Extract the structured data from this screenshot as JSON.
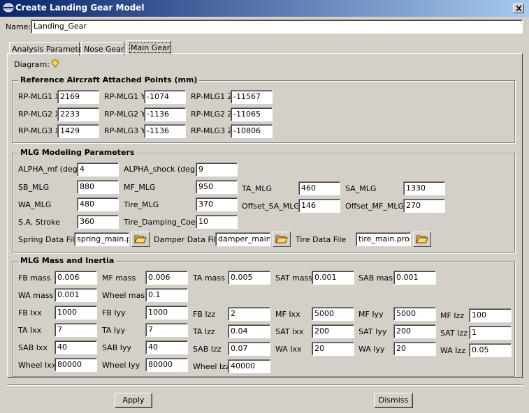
{
  "window": {
    "title": "Create Landing Gear Model"
  },
  "name_row": {
    "label": "Name:",
    "value": "Landing_Gear"
  },
  "tabs": [
    "Analysis Parameters",
    "Nose Gear",
    "Main Gear"
  ],
  "diagram": {
    "label": "Diagram:",
    "icon": "lightbulb-icon"
  },
  "ref_points": {
    "title": "Reference Aircraft Attached Points (mm)",
    "rows": [
      [
        {
          "label": "RP-MLG1 X",
          "value": "2169"
        },
        {
          "label": "RP-MLG1 Y",
          "value": "-1074"
        },
        {
          "label": "RP-MLG1 Z",
          "value": "-11567"
        }
      ],
      [
        {
          "label": "RP-MLG2 X",
          "value": "2233"
        },
        {
          "label": "RP-MLG2 Y",
          "value": "-1136"
        },
        {
          "label": "RP-MLG2 Z",
          "value": "-11065"
        }
      ],
      [
        {
          "label": "RP-MLG3 X",
          "value": "1429"
        },
        {
          "label": "RP-MLG3 Y",
          "value": "-1136"
        },
        {
          "label": "RP-MLG3 Z",
          "value": "-10806"
        }
      ]
    ]
  },
  "mlg_params": {
    "title": "MLG Modeling Parameters",
    "alpha_mf": {
      "label": "ALPHA_mf (deg)",
      "value": "4"
    },
    "alpha_shock": {
      "label": "ALPHA_shock (deg)",
      "value": "9"
    },
    "sb_mlg": {
      "label": "SB_MLG",
      "value": "880"
    },
    "mf_mlg": {
      "label": "MF_MLG",
      "value": "950"
    },
    "ta_mlg": {
      "label": "TA_MLG",
      "value": "460"
    },
    "sa_mlg": {
      "label": "SA_MLG",
      "value": "1330"
    },
    "wa_mlg": {
      "label": "WA_MLG",
      "value": "480"
    },
    "tire_mlg": {
      "label": "Tire_MLG",
      "value": "370"
    },
    "offset_sa": {
      "label": "Offset_SA_MLG",
      "value": "146"
    },
    "offset_mf": {
      "label": "Offset_MF_MLG",
      "value": "270"
    },
    "sa_stroke": {
      "label": "S.A. Stroke",
      "value": "360"
    },
    "tire_damping": {
      "label": "Tire_Damping_Coeff",
      "value": "10"
    },
    "spring_file": {
      "label": "Spring Data File",
      "value": "spring_main.prop"
    },
    "damper_file": {
      "label": "Damper Data File",
      "value": "damper_main.prop"
    },
    "tire_file": {
      "label": "Tire Data File",
      "value": "tire_main.prop"
    }
  },
  "mass": {
    "title": "MLG Mass and Inertia",
    "fb_mass": {
      "label": "FB mass",
      "value": "0.006"
    },
    "mf_mass": {
      "label": "MF mass",
      "value": "0.006"
    },
    "ta_mass": {
      "label": "TA mass",
      "value": "0.005"
    },
    "sat_mass": {
      "label": "SAT mass",
      "value": "0.001"
    },
    "sab_mass": {
      "label": "SAB mass",
      "value": "0.001"
    },
    "wa_mass": {
      "label": "WA mass",
      "value": "0.001"
    },
    "wheel_mass": {
      "label": "Wheel mass",
      "value": "0.1"
    },
    "fb_ixx": {
      "label": "FB Ixx",
      "value": "1000"
    },
    "fb_iyy": {
      "label": "FB Iyy",
      "value": "1000"
    },
    "fb_izz": {
      "label": "FB Izz",
      "value": "2"
    },
    "mf_ixx": {
      "label": "MF Ixx",
      "value": "5000"
    },
    "mf_iyy": {
      "label": "MF Iyy",
      "value": "5000"
    },
    "mf_izz": {
      "label": "MF Izz",
      "value": "100"
    },
    "ta_ixx": {
      "label": "TA Ixx",
      "value": "7"
    },
    "ta_iyy": {
      "label": "TA Iyy",
      "value": "7"
    },
    "ta_izz": {
      "label": "TA Izz",
      "value": "0.04"
    },
    "sat_ixx": {
      "label": "SAT Ixx",
      "value": "200"
    },
    "sat_iyy": {
      "label": "SAT Iyy",
      "value": "200"
    },
    "sat_izz": {
      "label": "SAT Izz",
      "value": "1"
    },
    "sab_ixx": {
      "label": "SAB Ixx",
      "value": "40"
    },
    "sab_iyy": {
      "label": "SAB Iyy",
      "value": "40"
    },
    "sab_izz": {
      "label": "SAB Izz",
      "value": "0.07"
    },
    "wa_ixx": {
      "label": "WA Ixx",
      "value": "20"
    },
    "wa_iyy": {
      "label": "WA Iyy",
      "value": "20"
    },
    "wa_izz": {
      "label": "WA Izz",
      "value": "0.05"
    },
    "wheel_ixx": {
      "label": "Wheel Ixx",
      "value": "80000"
    },
    "wheel_iyy": {
      "label": "Wheel Iyy",
      "value": "80000"
    },
    "wheel_izz": {
      "label": "Wheel Izz",
      "value": "40000"
    }
  },
  "buttons": {
    "apply": "Apply",
    "dismiss": "Dismiss"
  },
  "colors": {
    "title_bar": "#0a246a",
    "dialog_bg": "#d4d0c8"
  }
}
